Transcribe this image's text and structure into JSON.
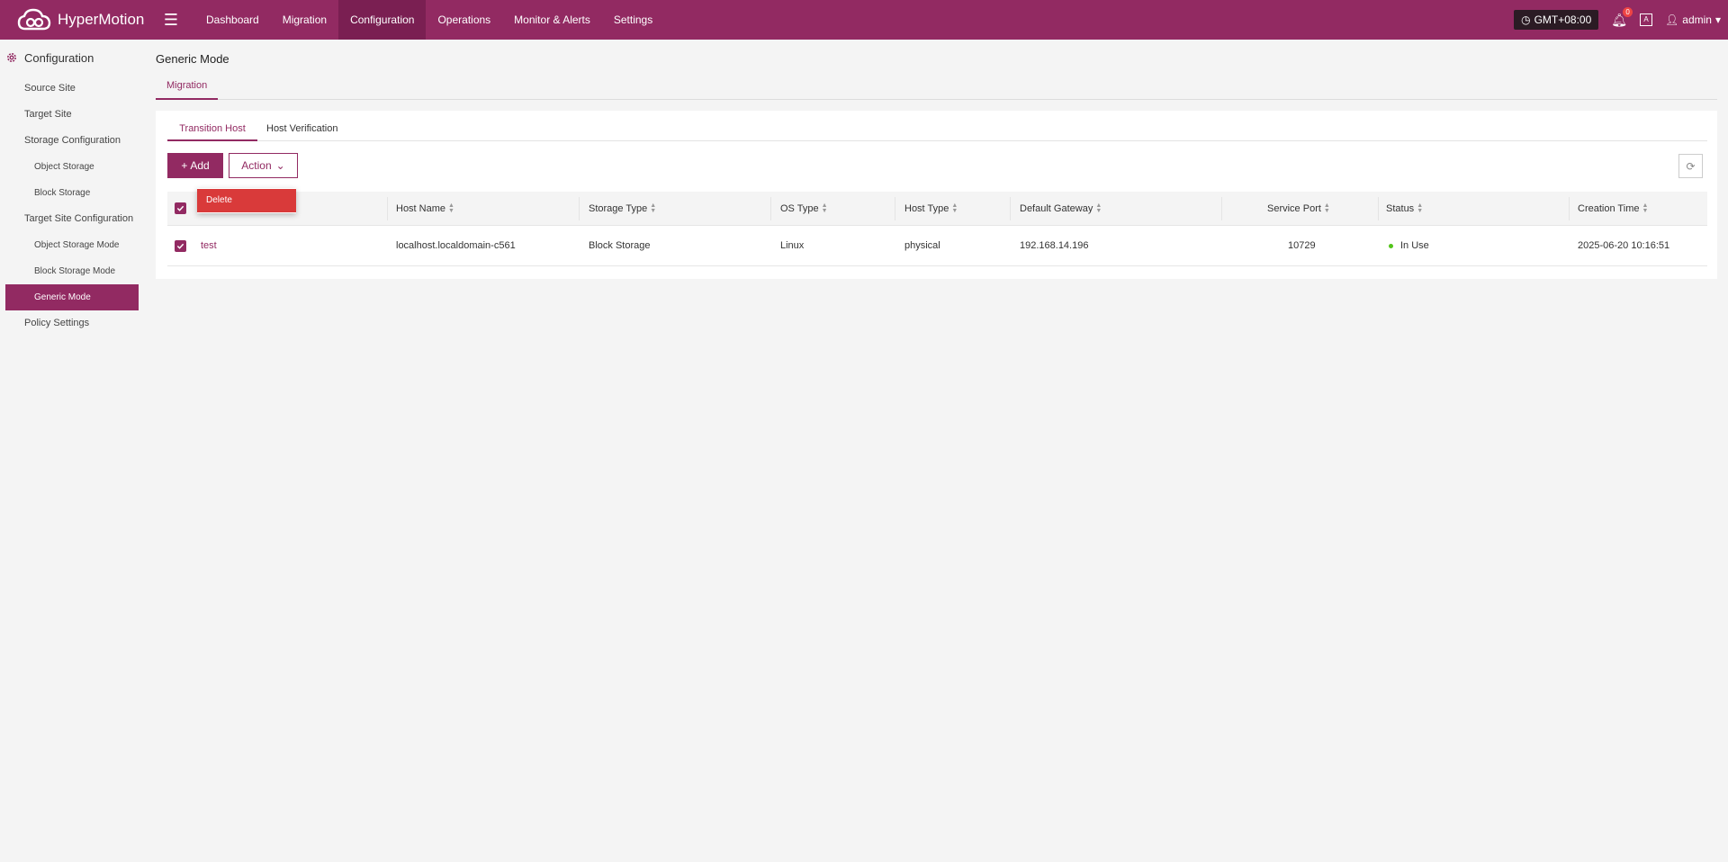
{
  "brand": {
    "name": "HyperMotion",
    "logo_icon": "cloud-logo-icon"
  },
  "nav": {
    "items": [
      "Dashboard",
      "Migration",
      "Configuration",
      "Operations",
      "Monitor & Alerts",
      "Settings"
    ],
    "active": "Configuration"
  },
  "header": {
    "timezone": "GMT+08:00",
    "notification_count": "0",
    "lang_icon_label": "A",
    "user": "admin"
  },
  "sidebar": {
    "title": "Configuration",
    "items": [
      {
        "label": "Source Site",
        "level": 1
      },
      {
        "label": "Target Site",
        "level": 1
      },
      {
        "label": "Storage Configuration",
        "level": 1
      },
      {
        "label": "Object Storage",
        "level": 2
      },
      {
        "label": "Block Storage",
        "level": 2
      },
      {
        "label": "Target Site Configuration",
        "level": 1
      },
      {
        "label": "Object Storage Mode",
        "level": 2
      },
      {
        "label": "Block Storage Mode",
        "level": 2
      },
      {
        "label": "Generic Mode",
        "level": 2,
        "active": true
      },
      {
        "label": "Policy Settings",
        "level": 1
      }
    ]
  },
  "page": {
    "title": "Generic Mode",
    "tab": "Migration",
    "subtabs": [
      "Transition Host",
      "Host Verification"
    ],
    "active_subtab": "Transition Host"
  },
  "toolbar": {
    "add_label": "Add",
    "action_label": "Action"
  },
  "dropdown": {
    "items": [
      "Delete"
    ]
  },
  "table": {
    "columns": [
      "Host Name",
      "Storage Type",
      "OS Type",
      "Host Type",
      "Default Gateway",
      "Service Port",
      "Status",
      "Creation Time"
    ],
    "rows": [
      {
        "checked": true,
        "name": "test",
        "host_name": "localhost.localdomain-c561",
        "storage_type": "Block Storage",
        "os_type": "Linux",
        "host_type": "physical",
        "default_gateway": "192.168.14.196",
        "service_port": "10729",
        "status": "In Use",
        "creation_time": "2025-06-20 10:16:51"
      }
    ]
  },
  "colors": {
    "accent": "#922a62",
    "active_nav": "#7a1f52",
    "danger": "#d93a3a",
    "status_ok": "#52c41a"
  }
}
